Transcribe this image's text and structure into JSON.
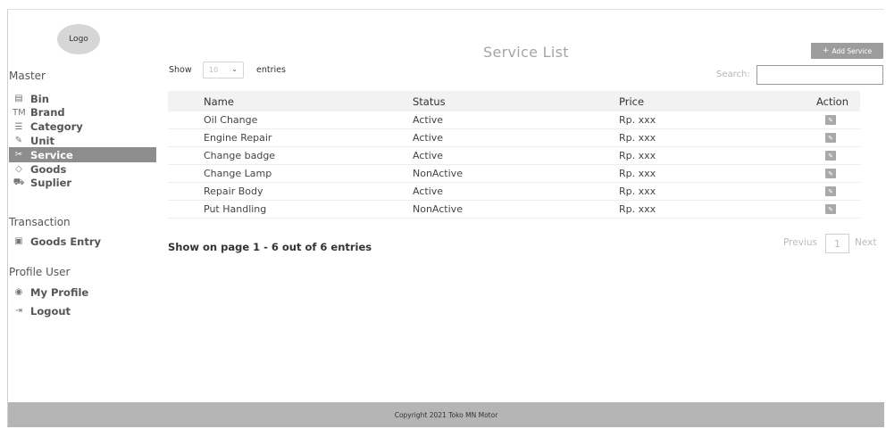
{
  "sidebar": {
    "logo_text": "Logo",
    "sections": {
      "master": "Master",
      "transaction": "Transaction",
      "profile": "Profile User"
    },
    "master_items": [
      {
        "label": "Bin",
        "icon": "bin-icon",
        "glyph": "▤"
      },
      {
        "label": "Brand",
        "icon": "brand-tm-icon",
        "glyph": "TM"
      },
      {
        "label": "Category",
        "icon": "category-icon",
        "glyph": "☰"
      },
      {
        "label": "Unit",
        "icon": "pencil-icon",
        "glyph": "✎"
      },
      {
        "label": "Service",
        "icon": "tools-icon",
        "glyph": "✂"
      },
      {
        "label": "Goods",
        "icon": "box-icon",
        "glyph": "◇"
      },
      {
        "label": "Suplier",
        "icon": "truck-icon",
        "glyph": "⛟"
      }
    ],
    "active_item": "Service",
    "transaction_items": [
      {
        "label": "Goods Entry",
        "icon": "clipboard-icon",
        "glyph": "▣"
      }
    ],
    "profile_items": [
      {
        "label": "My Profile",
        "icon": "user-icon",
        "glyph": "◉"
      },
      {
        "label": "Logout",
        "icon": "logout-icon",
        "glyph": "⇥"
      }
    ]
  },
  "header": {
    "title": "Service List",
    "add_button": "Add Service",
    "add_glyph": "+"
  },
  "controls": {
    "show_label": "Show",
    "entries_value": "10",
    "entries_label": "entries",
    "search_label": "Search:",
    "search_value": ""
  },
  "table": {
    "columns": [
      "Name",
      "Status",
      "Price",
      "Action"
    ],
    "rows": [
      {
        "name": "Oil Change",
        "status": "Active",
        "price": "Rp. xxx"
      },
      {
        "name": "Engine Repair",
        "status": "Active",
        "price": "Rp. xxx"
      },
      {
        "name": "Change badge",
        "status": "Active",
        "price": "Rp. xxx"
      },
      {
        "name": "Change Lamp",
        "status": "NonActive",
        "price": "Rp. xxx"
      },
      {
        "name": "Repair Body",
        "status": "Active",
        "price": "Rp. xxx"
      },
      {
        "name": "Put Handling",
        "status": "NonActive",
        "price": "Rp. xxx"
      }
    ]
  },
  "summary": "Show on page 1 - 6 out of 6 entries",
  "pagination": {
    "prev": "Previus",
    "current": "1",
    "next": "Next"
  },
  "footer": "Copyright 2021 Toko MN Motor"
}
